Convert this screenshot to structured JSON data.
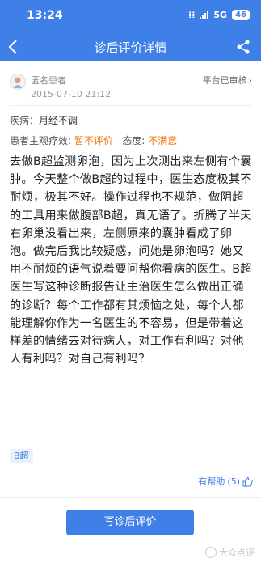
{
  "status": {
    "time": "13:24",
    "network": "5G",
    "battery": "46"
  },
  "nav": {
    "title": "诊后评价详情"
  },
  "author": {
    "name": "匿名患者",
    "date": "2015-07-10 21:12",
    "audit": "平台已审核"
  },
  "disease": {
    "label": "疾病：",
    "value": "月经不调"
  },
  "effect": {
    "label": "患者主观疗效:",
    "value": "暂不评价",
    "attitude_label": "态度:",
    "attitude_value": "不满意"
  },
  "review_text": "去做B超监测卵泡，因为上次测出来左侧有个囊肿。今天整个做B超的过程中，医生态度极其不耐烦，极其不好。操作过程也不规范，做阴超的工具用来做腹部B超，真无语了。折腾了半天右卵巢没看出来，左侧原来的囊肿看成了卵泡。做完后我比较疑惑，问她是卵泡吗？她又用不耐烦的语气说着要问帮你看病的医生。B超医生写这种诊断报告让主治医生怎么做出正确的诊断？每个工作都有其烦恼之处，每个人都能理解你作为一名医生的不容易，但是带着这样差的情绪去对待病人，对工作有利吗？对他人有利吗？对自己有利吗？",
  "tag": "B超",
  "helpful": {
    "label": "有帮助",
    "count": "(5)"
  },
  "write_button": "写诊后评价",
  "watermark": "大众点评",
  "colors": {
    "primary": "#3f7fe8",
    "orange": "#f07a17"
  }
}
